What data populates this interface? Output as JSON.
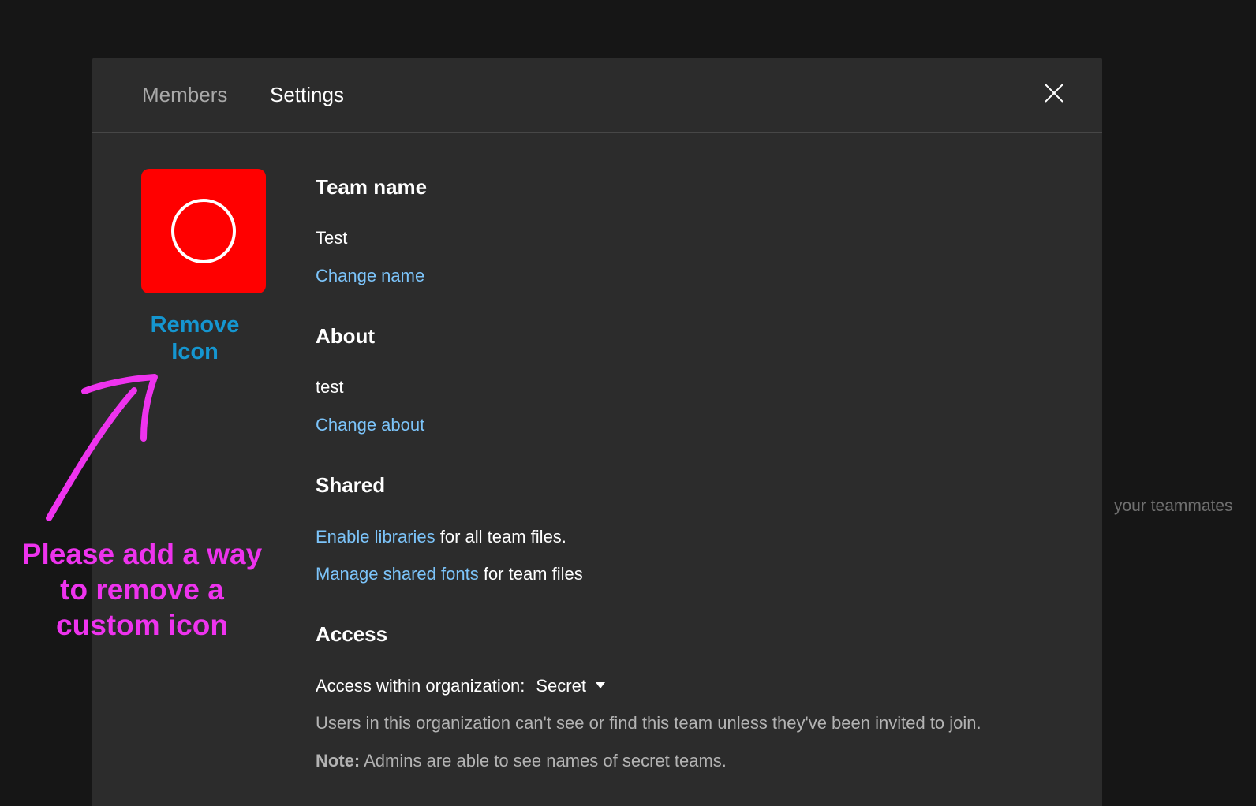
{
  "background": {
    "partial_text": "your teammates"
  },
  "tabs": [
    {
      "label": "Members",
      "active": false
    },
    {
      "label": "Settings",
      "active": true
    }
  ],
  "close_icon": "close-icon",
  "team_icon": {
    "color": "#ff0000",
    "glyph": "circle-icon"
  },
  "remove_icon_label": "Remove Icon",
  "team_name": {
    "heading": "Team name",
    "value": "Test",
    "link": "Change name"
  },
  "about": {
    "heading": "About",
    "value": "test",
    "link": "Change about"
  },
  "shared": {
    "heading": "Shared",
    "libraries_link": "Enable libraries",
    "libraries_text": " for all team files.",
    "fonts_link": "Manage shared fonts",
    "fonts_text": " for team files"
  },
  "access": {
    "heading": "Access",
    "label": "Access within organization:",
    "selected": "Secret",
    "description": "Users in this organization can't see or find this team unless they've been invited to join.",
    "note_label": "Note:",
    "note_text": " Admins are able to see names of secret teams."
  },
  "annotation": {
    "text": "Please add a way to remove a custom icon",
    "color": "#ee33ee"
  },
  "colors": {
    "link": "#7cc4fa",
    "remove_link": "#1596d0",
    "modal_bg": "#2c2c2c",
    "page_bg": "#161616"
  }
}
